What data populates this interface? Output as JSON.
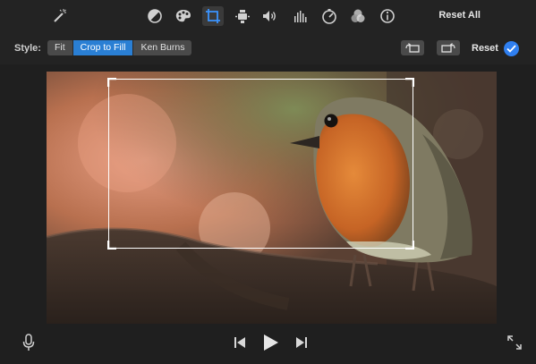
{
  "toolbar": {
    "icons": [
      "magic-wand-icon",
      "color-balance-icon",
      "palette-icon",
      "crop-icon",
      "stabilization-icon",
      "volume-icon",
      "equalizer-icon",
      "speed-icon",
      "filter-icon",
      "info-icon"
    ],
    "reset_all_label": "Reset All"
  },
  "style_bar": {
    "label": "Style:",
    "options": [
      "Fit",
      "Crop to Fill",
      "Ken Burns"
    ],
    "selected": "Crop to Fill",
    "reset_label": "Reset"
  },
  "colors": {
    "accent": "#2a7fd4",
    "confirm": "#2f7ff0",
    "background": "#1f1f1f"
  },
  "viewer": {
    "image": "robin-on-branch",
    "crop_enabled": true
  },
  "playback": {
    "icons": [
      "microphone-icon",
      "skip-back-icon",
      "play-icon",
      "skip-forward-icon",
      "fullscreen-icon"
    ]
  }
}
